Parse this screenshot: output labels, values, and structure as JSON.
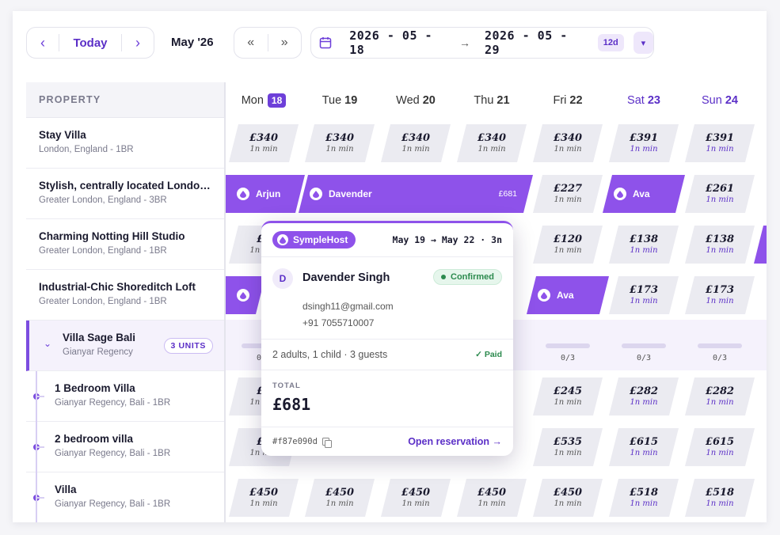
{
  "toolbar": {
    "prev_icon": "chevron-left-icon",
    "today_label": "Today",
    "next_icon": "chevron-right-icon",
    "month_label": "May '26",
    "jump_back_icon": "double-chevron-left-icon",
    "jump_fwd_icon": "double-chevron-right-icon",
    "range_start": "2026 - 05 - 18",
    "range_end": "2026 - 05 - 29",
    "range_days": "12d"
  },
  "grid": {
    "property_header": "PROPERTY",
    "days": [
      {
        "dow": "Mon",
        "num": "18",
        "today": true,
        "weekend": false
      },
      {
        "dow": "Tue",
        "num": "19",
        "today": false,
        "weekend": false
      },
      {
        "dow": "Wed",
        "num": "20",
        "today": false,
        "weekend": false
      },
      {
        "dow": "Thu",
        "num": "21",
        "today": false,
        "weekend": false
      },
      {
        "dow": "Fri",
        "num": "22",
        "today": false,
        "weekend": false
      },
      {
        "dow": "Sat",
        "num": "23",
        "today": false,
        "weekend": true
      },
      {
        "dow": "Sun",
        "num": "24",
        "today": false,
        "weekend": true
      }
    ],
    "properties": [
      {
        "name": "Stay Villa",
        "sub": "London, England - 1BR"
      },
      {
        "name": "Stylish, centrally located London apartment",
        "sub": "Greater London, England - 3BR"
      },
      {
        "name": "Charming Notting Hill Studio",
        "sub": "Greater London, England - 1BR"
      },
      {
        "name": "Industrial-Chic Shoreditch Loft",
        "sub": "Greater London, England - 1BR"
      },
      {
        "name": "Villa Sage Bali",
        "sub": "Gianyar Regency",
        "units": "3 UNITS"
      },
      {
        "name": "1 Bedroom Villa",
        "sub": "Gianyar Regency, Bali - 1BR"
      },
      {
        "name": "2 bedroom villa",
        "sub": "Gianyar Regency, Bali - 1BR"
      },
      {
        "name": "Villa",
        "sub": "Gianyar Regency, Bali - 1BR"
      }
    ],
    "min_label": "1n min",
    "row0": [
      "£340",
      "£340",
      "£340",
      "£340",
      "£340",
      "£391",
      "£391"
    ],
    "row1": {
      "fri": "£227",
      "sun": "£261"
    },
    "row2": {
      "fri": "£120",
      "sat": "£138",
      "sun": "£138"
    },
    "row3": {
      "sat": "£173",
      "sun": "£173"
    },
    "row4_caps": [
      "0/3",
      "0/3",
      "0/3",
      "0/3"
    ],
    "row5": {
      "fri": "£245",
      "sat": "£282",
      "sun": "£282"
    },
    "row6": {
      "fri": "£535",
      "sat": "£615",
      "sun": "£615"
    },
    "row7": [
      "£450",
      "£450",
      "£450",
      "£450",
      "£450",
      "£518",
      "£518"
    ],
    "partial": {
      "row2": "£1",
      "row5": "£2",
      "row6": "£5"
    }
  },
  "bookings": {
    "arjun": {
      "name": "Arjun"
    },
    "davender": {
      "name": "Davender",
      "amount": "£681"
    },
    "ava1": {
      "name": "Ava"
    },
    "ava2": {
      "name": "Ava"
    }
  },
  "popover": {
    "host": "SympleHost",
    "dates": "May 19 → May 22 · 3n",
    "avatar": "D",
    "guest_name": "Davender Singh",
    "status": "Confirmed",
    "email": "dsingh11@gmail.com",
    "phone": "+91 7055710007",
    "guests": "2 adults, 1 child · 3 guests",
    "paid": "✓ Paid",
    "total_label": "TOTAL",
    "total": "£681",
    "res_id": "#f87e090d",
    "open_link": "Open reservation →"
  },
  "colors": {
    "accent": "#6d3fd9",
    "booking": "#8e52ea",
    "confirmed": "#2c8a4e"
  }
}
